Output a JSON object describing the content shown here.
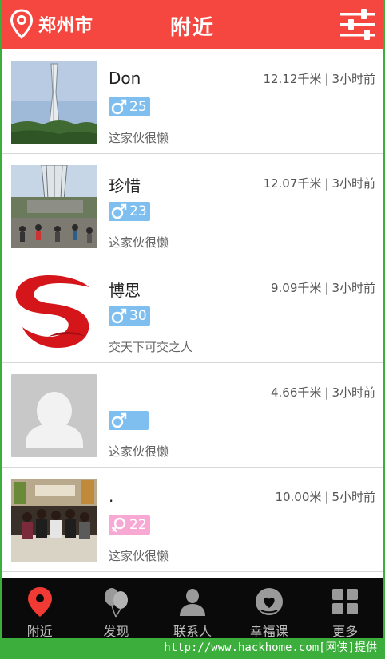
{
  "header": {
    "city": "郑州市",
    "title": "附近",
    "location_icon": "location-pin-icon",
    "filter_icon": "filter-sliders-icon",
    "color": "#f5473f"
  },
  "users": [
    {
      "name": "Don",
      "distance": "12.12千米",
      "time": "3小时前",
      "gender": "male",
      "age": "25",
      "signature": "这家伙很懒",
      "avatar": "canton-tower-photo"
    },
    {
      "name": "珍惜",
      "distance": "12.07千米",
      "time": "3小时前",
      "gender": "male",
      "age": "23",
      "signature": "这家伙很懒",
      "avatar": "canton-tower-crowd-photo"
    },
    {
      "name": "博思",
      "distance": "9.09千米",
      "time": "3小时前",
      "gender": "male",
      "age": "30",
      "signature": "交天下可交之人",
      "avatar": "red-logo"
    },
    {
      "name": "",
      "distance": "4.66千米",
      "time": "3小时前",
      "gender": "male",
      "age": "",
      "signature": "这家伙很懒",
      "avatar": "default-avatar"
    },
    {
      "name": ".",
      "distance": "10.00米",
      "time": "5小时前",
      "gender": "female",
      "age": "22",
      "signature": "这家伙很懒",
      "avatar": "group-photo"
    }
  ],
  "separator": "|",
  "nav": [
    {
      "label": "附近",
      "icon": "location-pin-icon",
      "active": true
    },
    {
      "label": "发现",
      "icon": "balloons-icon",
      "active": false
    },
    {
      "label": "联系人",
      "icon": "person-icon",
      "active": false
    },
    {
      "label": "幸福课",
      "icon": "heart-face-icon",
      "active": false
    },
    {
      "label": "更多",
      "icon": "grid-icon",
      "active": false
    }
  ],
  "watermark": "http://www.hackhome.com[网侠]提供",
  "colors": {
    "male_badge": "#7ebff0",
    "female_badge": "#f7a9d4",
    "nav_bg": "#0a0a0a"
  }
}
